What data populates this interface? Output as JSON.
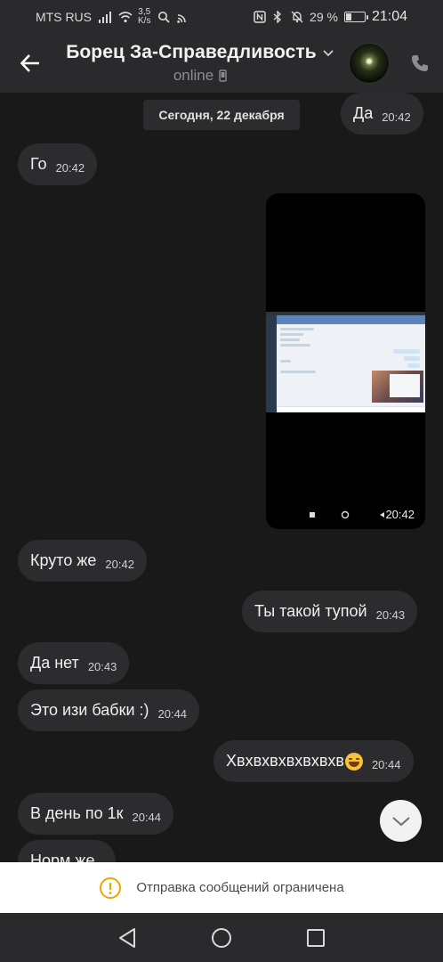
{
  "status_bar": {
    "carrier": "MTS RUS",
    "speed_value": "3,5",
    "speed_unit": "K/s",
    "battery_percent": "29 %",
    "battery_level": 0.29,
    "time": "21:04"
  },
  "header": {
    "contact_name": "Борец За-Справедливость",
    "status": "online"
  },
  "chat": {
    "date_separator": "Сегодня, 22 декабря",
    "messages": [
      {
        "direction": "out",
        "text": "Да",
        "time": "20:42"
      },
      {
        "direction": "in",
        "text": "Го",
        "time": "20:42"
      },
      {
        "direction": "in",
        "type": "image",
        "time": "20:42"
      },
      {
        "direction": "in",
        "text": "Круто же",
        "time": "20:42"
      },
      {
        "direction": "out",
        "text": "Ты такой тупой",
        "time": "20:43"
      },
      {
        "direction": "in",
        "text": "Да нет",
        "time": "20:43"
      },
      {
        "direction": "in",
        "text": "Это изи бабки :)",
        "time": "20:44"
      },
      {
        "direction": "out",
        "text": "Хвхвхвхвхвхвхв",
        "emoji": "rofl-emoji",
        "time": "20:44"
      },
      {
        "direction": "in",
        "text": "В день по 1к",
        "time": "20:44"
      },
      {
        "direction": "in",
        "text": "Норм же",
        "time": ""
      }
    ]
  },
  "restriction": {
    "text": "Отправка сообщений ограничена"
  },
  "colors": {
    "background": "#19191a",
    "bubble": "#2c2c2e",
    "bar": "#2a2a2c",
    "warning": "#f0a500"
  }
}
